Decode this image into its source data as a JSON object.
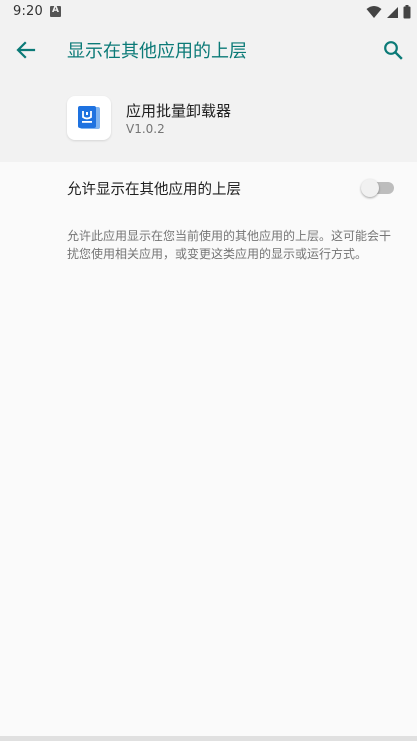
{
  "status_bar": {
    "time": "9:20",
    "icons": [
      "notification-a-icon",
      "wifi-icon",
      "signal-icon",
      "battery-icon"
    ]
  },
  "app_bar": {
    "title": "显示在其他应用的上层",
    "back_icon": "arrow-back-icon",
    "search_icon": "search-icon"
  },
  "app": {
    "name": "应用批量卸载器",
    "version": "V1.0.2",
    "icon": "app-icon"
  },
  "setting": {
    "label": "允许显示在其他应用的上层",
    "enabled": false,
    "description": "允许此应用显示在您当前使用的其他应用的上层。这可能会干扰您使用相关应用，或变更这类应用的显示或运行方式。"
  },
  "colors": {
    "accent": "#0b7a77",
    "header_bg": "#f2f2f2",
    "body_bg": "#fafafa",
    "app_icon_blue": "#1e72e0"
  }
}
